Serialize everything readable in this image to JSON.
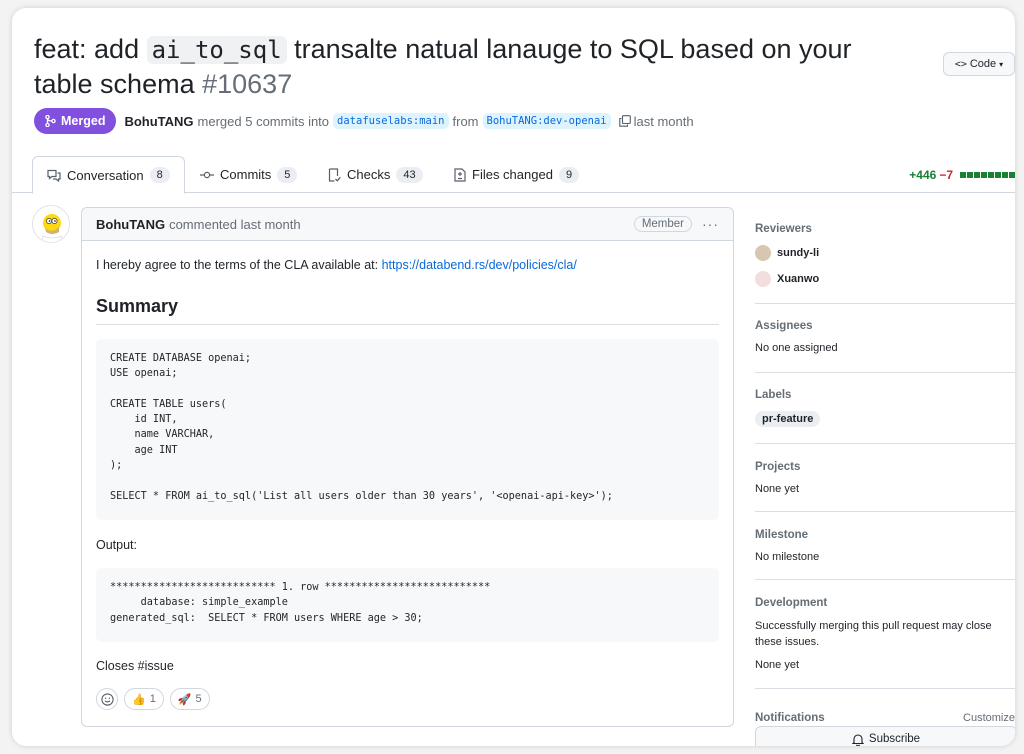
{
  "header": {
    "title_pre": "feat: add ",
    "title_code": "ai_to_sql",
    "title_post": " transalte natual lanauge to SQL based on your table schema",
    "pr_number": "#10637",
    "code_button": "Code"
  },
  "meta": {
    "status": "Merged",
    "author": "BohuTANG",
    "merge_text": "merged 5 commits into",
    "base_branch": "datafuselabs:main",
    "from_text": "from",
    "head_branch": "BohuTANG:dev-openai",
    "time": "last month"
  },
  "tabs": [
    {
      "label": "Conversation",
      "count": "8",
      "icon": "comment-discussion-icon"
    },
    {
      "label": "Commits",
      "count": "5",
      "icon": "commit-icon"
    },
    {
      "label": "Checks",
      "count": "43",
      "icon": "checklist-icon"
    },
    {
      "label": "Files changed",
      "count": "9",
      "icon": "file-diff-icon"
    }
  ],
  "diffstat": {
    "additions": "+446",
    "deletions": "−7"
  },
  "comment": {
    "author": "BohuTANG",
    "action": "commented last month",
    "role": "Member",
    "cla_text": "I hereby agree to the terms of the CLA available at: ",
    "cla_link": "https://databend.rs/dev/policies/cla/",
    "summary_heading": "Summary",
    "code1": "CREATE DATABASE openai;\nUSE openai;\n\nCREATE TABLE users(\n    id INT,\n    name VARCHAR,\n    age INT\n);\n\nSELECT * FROM ai_to_sql('List all users older than 30 years', '<openai-api-key>');",
    "output_label": "Output:",
    "code2": "*************************** 1. row ***************************\n     database: simple_example\ngenerated_sql:  SELECT * FROM users WHERE age > 30;",
    "closes": "Closes #issue",
    "reactions": [
      {
        "emoji": "👍",
        "count": "1"
      },
      {
        "emoji": "🚀",
        "count": "5"
      }
    ]
  },
  "sidebar": {
    "reviewers_title": "Reviewers",
    "reviewers": [
      "sundy-li",
      "Xuanwo"
    ],
    "assignees_title": "Assignees",
    "assignees_text": "No one assigned",
    "labels_title": "Labels",
    "label": "pr-feature",
    "projects_title": "Projects",
    "projects_text": "None yet",
    "milestone_title": "Milestone",
    "milestone_text": "No milestone",
    "development_title": "Development",
    "development_text": "Successfully merging this pull request may close these issues.",
    "development_none": "None yet",
    "notifications_title": "Notifications",
    "customize": "Customize",
    "subscribe": "Subscribe"
  },
  "colors": {
    "merged": "#8250df",
    "link": "#0969da",
    "additions": "#1a7f37",
    "deletions": "#cf222e"
  }
}
